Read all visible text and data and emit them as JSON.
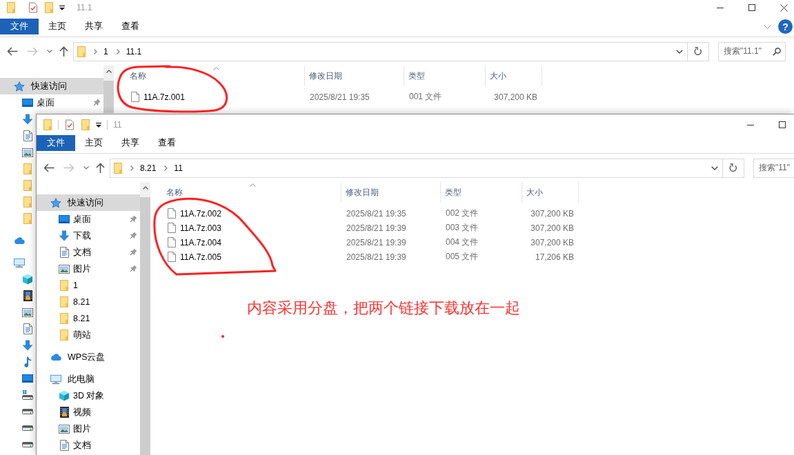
{
  "back_window": {
    "title": "11.1",
    "ribbon": {
      "file_button": "文件",
      "tabs": [
        {
          "label": "主页",
          "selected": false
        },
        {
          "label": "共享",
          "selected": false
        },
        {
          "label": "查看",
          "selected": false
        }
      ],
      "help": "?"
    },
    "address": {
      "back_enabled": true,
      "forward_enabled": false,
      "path": [
        "1",
        "11.1"
      ]
    },
    "search": {
      "placeholder": "搜索\"11.1\""
    },
    "nav": [
      {
        "kind": "star",
        "label": "快速访问",
        "selected": true,
        "pinned": false,
        "children": [
          {
            "kind": "desktop",
            "label": "桌面",
            "selected": false,
            "pinned": true
          },
          {
            "kind": "download",
            "selected": false,
            "pinned": false
          },
          {
            "kind": "document",
            "selected": false,
            "pinned": false
          },
          {
            "kind": "picture",
            "selected": false,
            "pinned": false
          },
          {
            "kind": "folder",
            "selected": false,
            "pinned": false
          },
          {
            "kind": "folder",
            "selected": false,
            "pinned": false
          },
          {
            "kind": "folder",
            "selected": false,
            "pinned": false
          },
          {
            "kind": "folder",
            "selected": false,
            "pinned": false
          }
        ]
      },
      {
        "kind": "cloud",
        "selected": false,
        "pinned": false
      },
      {
        "kind": "computer",
        "selected": false,
        "pinned": false,
        "children": [
          {
            "kind": "cube",
            "selected": false,
            "pinned": false
          },
          {
            "kind": "film",
            "selected": false,
            "pinned": false
          },
          {
            "kind": "picture",
            "selected": false,
            "pinned": false
          },
          {
            "kind": "document",
            "selected": false,
            "pinned": false
          },
          {
            "kind": "download",
            "selected": false,
            "pinned": false
          },
          {
            "kind": "music",
            "selected": false,
            "pinned": false
          },
          {
            "kind": "desktop",
            "selected": false,
            "pinned": false
          },
          {
            "kind": "systemdrive",
            "selected": false,
            "pinned": false
          },
          {
            "kind": "drive",
            "selected": false,
            "pinned": false
          },
          {
            "kind": "drive",
            "selected": false,
            "pinned": false
          },
          {
            "kind": "drive",
            "selected": false,
            "pinned": false
          }
        ]
      }
    ],
    "columns": [
      {
        "label": "名称",
        "sorted": true
      },
      {
        "label": "修改日期",
        "sorted": false
      },
      {
        "label": "类型",
        "sorted": false
      },
      {
        "label": "大小",
        "sorted": false
      }
    ],
    "files": [
      {
        "name": "11A.7z.001",
        "modified": "2025/8/21 19:35",
        "type": "001 文件",
        "size": "307,200 KB"
      }
    ]
  },
  "front_window": {
    "title": "11",
    "ribbon": {
      "file_button": "文件",
      "tabs": [
        {
          "label": "主页",
          "selected": false
        },
        {
          "label": "共享",
          "selected": false
        },
        {
          "label": "查看",
          "selected": false
        }
      ]
    },
    "address": {
      "back_enabled": true,
      "forward_enabled": false,
      "path": [
        "8.21",
        "11"
      ]
    },
    "search": {
      "placeholder": "搜索\"11\""
    },
    "nav": [
      {
        "kind": "star",
        "label": "快速访问",
        "selected": true,
        "pinned": false,
        "children": [
          {
            "kind": "desktop",
            "label": "桌面",
            "selected": false,
            "pinned": true
          },
          {
            "kind": "download",
            "label": "下载",
            "selected": false,
            "pinned": true
          },
          {
            "kind": "document",
            "label": "文档",
            "selected": false,
            "pinned": true
          },
          {
            "kind": "picture",
            "label": "图片",
            "selected": false,
            "pinned": true
          },
          {
            "kind": "folder",
            "label": "1",
            "selected": false,
            "pinned": false
          },
          {
            "kind": "folder",
            "label": "8.21",
            "selected": false,
            "pinned": false
          },
          {
            "kind": "folder",
            "label": "8.21",
            "selected": false,
            "pinned": false
          },
          {
            "kind": "folder",
            "label": "萌站",
            "selected": false,
            "pinned": false
          }
        ]
      },
      {
        "kind": "cloud",
        "label": "WPS云盘",
        "selected": false,
        "pinned": false
      },
      {
        "kind": "computer",
        "label": "此电脑",
        "selected": false,
        "pinned": false,
        "children": [
          {
            "kind": "cube",
            "label": "3D 对象",
            "selected": false,
            "pinned": false
          },
          {
            "kind": "film",
            "label": "视频",
            "selected": false,
            "pinned": false
          },
          {
            "kind": "picture",
            "label": "图片",
            "selected": false,
            "pinned": false
          },
          {
            "kind": "document",
            "label": "文档",
            "selected": false,
            "pinned": false
          }
        ]
      }
    ],
    "columns": [
      {
        "label": "名称",
        "sorted": true
      },
      {
        "label": "修改日期",
        "sorted": false
      },
      {
        "label": "类型",
        "sorted": false
      },
      {
        "label": "大小",
        "sorted": false
      }
    ],
    "files": [
      {
        "name": "11A.7z.002",
        "modified": "2025/8/21 19:35",
        "type": "002 文件",
        "size": "307,200 KB"
      },
      {
        "name": "11A.7z.003",
        "modified": "2025/8/21 19:39",
        "type": "003 文件",
        "size": "307,200 KB"
      },
      {
        "name": "11A.7z.004",
        "modified": "2025/8/21 19:39",
        "type": "004 文件",
        "size": "307,200 KB"
      },
      {
        "name": "11A.7z.005",
        "modified": "2025/8/21 19:39",
        "type": "005 文件",
        "size": "17,206 KB"
      }
    ]
  },
  "annotation": {
    "note": "内容采用分盘，把两个链接下载放在一起"
  }
}
